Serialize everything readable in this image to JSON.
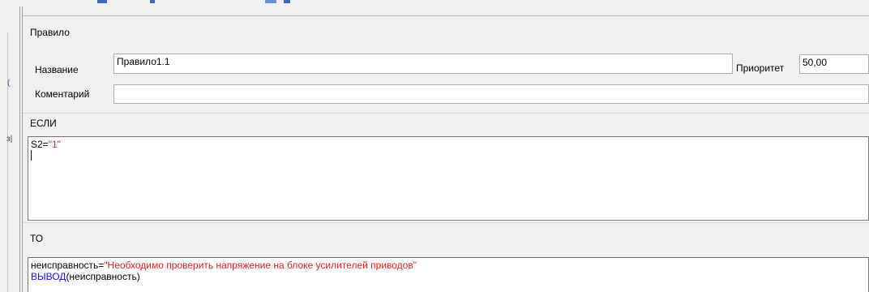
{
  "section_title": "Правило",
  "name": {
    "label": "Название",
    "value": "Правило1.1"
  },
  "priority": {
    "label": "Приоритет",
    "value": "50,00"
  },
  "comment": {
    "label": "Коментарий",
    "value": ""
  },
  "if_block": {
    "title": "ЕСЛИ",
    "code": [
      {
        "lhs": "S2=",
        "string": "\"1\""
      }
    ]
  },
  "then_block": {
    "title": "ТО",
    "line1": {
      "lhs": "неисправность=",
      "string": "\"Необходимо проверить напряжение на блоке усилителей приводов\""
    },
    "line2": {
      "keyword": "ВЫВОД",
      "args": "(неисправность)"
    }
  },
  "side_glyphs": {
    "a": "з|",
    "b": "("
  },
  "colors": {
    "string": "#e81f1f",
    "keyword": "#1515e0"
  }
}
